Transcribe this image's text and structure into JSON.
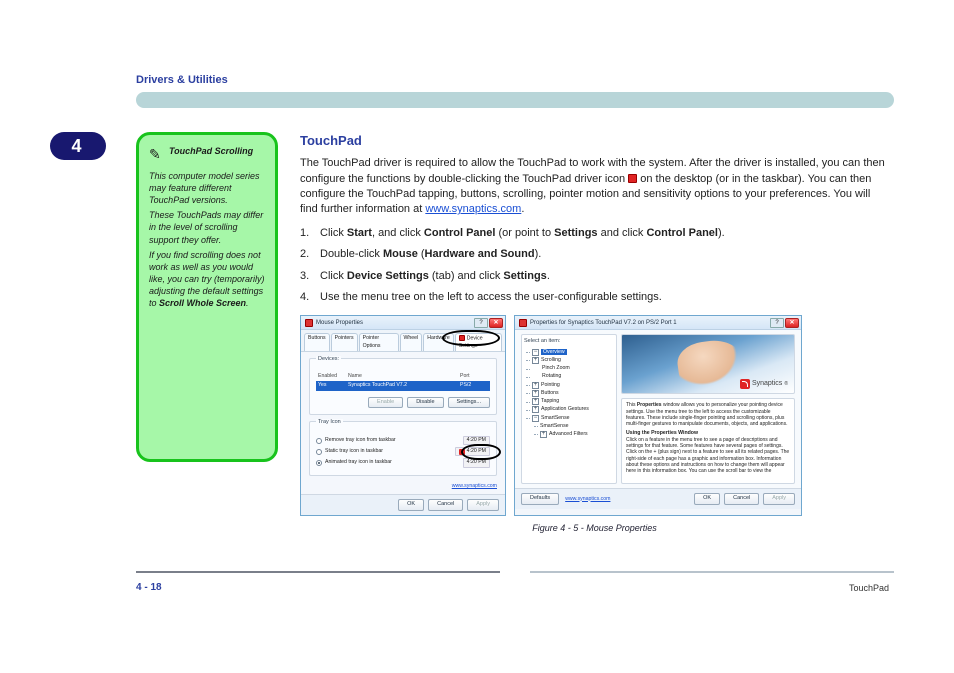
{
  "section_header": "Drivers & Utilities",
  "badge": {
    "big": "4",
    "small": ""
  },
  "note_box": {
    "title": "TouchPad Scrolling",
    "p1_a": "This computer model series may feature different TouchPad versions.",
    "p2": "These TouchPads may differ in the level of scrolling support they offer.",
    "p3_a": "If you find scrolling does not work as well as you would like, you can try (temporarily) adjusting the default settings to ",
    "p3_b": "Scroll Whole Screen",
    "p3_c": "."
  },
  "main": {
    "heading": "TouchPad",
    "intro_a": "The TouchPad driver is required to allow the TouchPad to work with the system. After the driver is installed, you can then configure the functions by double-clicking the TouchPad driver icon ",
    "intro_b": " on the desktop (or in the taskbar). You can then configure the TouchPad tapping, buttons, scrolling, pointer motion and sensitivity options to your preferences. You will find further information at ",
    "link": "www.synaptics.com",
    "intro_c": ".",
    "steps": [
      {
        "n": "1.",
        "a": "Click ",
        "b": "Start",
        "c": ", and click ",
        "d": "Control Panel",
        "e": " (or point to ",
        "f": "Settings",
        "g": " and click ",
        "h": "Control Panel",
        "i": ")."
      },
      {
        "n": "2.",
        "a": "Double-click ",
        "b": "Mouse",
        "c": " (",
        "d": "Hardware and Sound",
        "e": ")."
      },
      {
        "n": "3.",
        "a": "Click ",
        "b": "Device Settings",
        "c": " (tab) and click ",
        "d": "Settings",
        "e": "."
      },
      {
        "n": "4.",
        "a": "Use the menu tree on the left to access the user-configurable settings.",
        "b": "",
        "c": "",
        "d": "",
        "e": ""
      }
    ]
  },
  "dlg1": {
    "title": "Mouse Properties",
    "tabs": [
      "Buttons",
      "Pointers",
      "Pointer Options",
      "Wheel",
      "Hardware",
      "Device Settings"
    ],
    "devices_label": "Devices:",
    "head": {
      "c1": "Enabled",
      "c2": "Name",
      "c3": "Port"
    },
    "row": {
      "c1": "Yes",
      "c2": "Synaptics TouchPad V7.2",
      "c3": "PS/2"
    },
    "btn_enable": "Enable",
    "btn_disable": "Disable",
    "btn_settings": "Settings...",
    "tray_label": "Tray Icon",
    "tray": [
      {
        "label": "Remove tray icon from taskbar",
        "time": "4:20 PM"
      },
      {
        "label": "Static tray icon in taskbar",
        "time": "4:20 PM"
      },
      {
        "label": "Animated tray icon in taskbar",
        "time": "4:20 PM"
      }
    ],
    "link": "www.synaptics.com",
    "ok": "OK",
    "cancel": "Cancel",
    "apply": "Apply"
  },
  "dlg2": {
    "title": "Properties for Synaptics TouchPad V7.2 on PS/2 Port 1",
    "select_label": "Select an item:",
    "tree": {
      "overview": "Overview",
      "scrolling": "Scrolling",
      "pinch": "Pinch Zoom",
      "rotating": "Rotating",
      "pointing": "Pointing",
      "buttons": "Buttons",
      "tapping": "Tapping",
      "appg": "Application Gestures",
      "smart": "SmartSense",
      "smartsub": "SmartSense",
      "adv": "Advanced Filters"
    },
    "syn": "Synaptics",
    "desc1_a": "This ",
    "desc1_b": "Properties",
    "desc1_c": " window allows you to personalize your pointing device settings. Use the menu tree to the left to access the customizable features. These include single-finger pointing and scrolling options, plus multi-finger gestures to manipulate documents, objects, and applications.",
    "subhead": "Using the Properties Window",
    "desc2": "Click on a feature in the menu tree to see a page of descriptions and settings for that feature. Some features have several pages of settings. Click on the + (plus sign) next to a feature to see all its related pages. The right-side of each page has a graphic and information box. Information about these options and instructions on how to change them will appear here in this information box. You can use the scroll bar to view the",
    "defaults": "Defaults",
    "link": "www.synaptics.com",
    "ok": "OK",
    "cancel": "Cancel",
    "apply": "Apply"
  },
  "caption": "Figure 4 - 5 - Mouse Properties",
  "footer_left": "4 - 18",
  "footer_right": "TouchPad"
}
